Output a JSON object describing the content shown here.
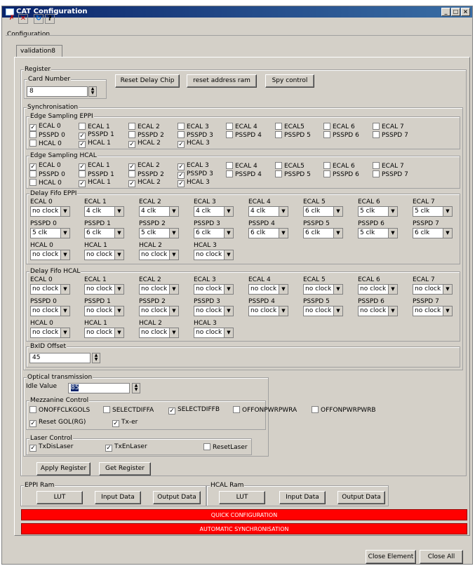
{
  "window": {
    "title": "CAT Configuration"
  },
  "toolbar": {
    "icons": [
      "remove-all-icon",
      "remove-icon",
      "refresh-icon",
      "help-icon"
    ]
  },
  "configuration_label": "Configuration",
  "tab_label": "validation8",
  "register": {
    "label": "Register",
    "card_number_label": "Card Number",
    "card_number": "8",
    "reset_delay_chip": "Reset Delay Chip",
    "reset_address_ram": "reset address ram",
    "spy_control": "Spy control"
  },
  "synchronisation": {
    "label": "Synchronisation",
    "edge_eppi": {
      "label": "Edge Sampling EPPI",
      "items": [
        {
          "label": "ECAL 0",
          "checked": true
        },
        {
          "label": "ECAL 1",
          "checked": false
        },
        {
          "label": "ECAL 2",
          "checked": false
        },
        {
          "label": "ECAL 3",
          "checked": false
        },
        {
          "label": "ECAL 4",
          "checked": false
        },
        {
          "label": "ECAL5",
          "checked": false
        },
        {
          "label": "ECAL 6",
          "checked": false
        },
        {
          "label": "ECAL 7",
          "checked": false
        },
        {
          "label": "PSSPD 0",
          "checked": false
        },
        {
          "label": "PSSPD 1",
          "checked": true
        },
        {
          "label": "PSSPD 2",
          "checked": false
        },
        {
          "label": "PSSPD 3",
          "checked": false
        },
        {
          "label": "PSSPD 4",
          "checked": false
        },
        {
          "label": "PSSPD 5",
          "checked": false
        },
        {
          "label": "PSSPD 6",
          "checked": false
        },
        {
          "label": "PSSPD 7",
          "checked": false
        },
        {
          "label": "HCAL 0",
          "checked": false
        },
        {
          "label": "HCAL 1",
          "checked": true
        },
        {
          "label": "HCAL 2",
          "checked": true
        },
        {
          "label": "HCAL 3",
          "checked": true
        }
      ]
    },
    "edge_hcal": {
      "label": "Edge Sampling HCAL",
      "items": [
        {
          "label": "ECAL 0",
          "checked": true
        },
        {
          "label": "ECAL 1",
          "checked": true
        },
        {
          "label": "ECAL 2",
          "checked": true
        },
        {
          "label": "ECAL 3",
          "checked": true
        },
        {
          "label": "ECAL 4",
          "checked": false
        },
        {
          "label": "ECAL5",
          "checked": false
        },
        {
          "label": "ECAL 6",
          "checked": false
        },
        {
          "label": "ECAL 7",
          "checked": false
        },
        {
          "label": "PSSPD 0",
          "checked": false
        },
        {
          "label": "PSSPD 1",
          "checked": false
        },
        {
          "label": "PSSPD 2",
          "checked": false
        },
        {
          "label": "PSSPD 3",
          "checked": true
        },
        {
          "label": "PSSPD 4",
          "checked": false
        },
        {
          "label": "PSSPD 5",
          "checked": false
        },
        {
          "label": "PSSPD 6",
          "checked": false
        },
        {
          "label": "PSSPD 7",
          "checked": false
        },
        {
          "label": "HCAL 0",
          "checked": false
        },
        {
          "label": "HCAL 1",
          "checked": true
        },
        {
          "label": "HCAL 2",
          "checked": true
        },
        {
          "label": "HCAL 3",
          "checked": true
        }
      ]
    },
    "fifo_eppi": {
      "label": "Delay Fifo EPPI",
      "items": [
        {
          "label": "ECAL 0",
          "value": "no clock"
        },
        {
          "label": "ECAL 1",
          "value": "4 clk"
        },
        {
          "label": "ECAL 2",
          "value": "4 clk"
        },
        {
          "label": "ECAL 3",
          "value": "4 clk"
        },
        {
          "label": "ECAL 4",
          "value": "4 clk"
        },
        {
          "label": "ECAL 5",
          "value": "6 clk"
        },
        {
          "label": "ECAL 6",
          "value": "5 clk"
        },
        {
          "label": "ECAL 7",
          "value": "5 clk"
        },
        {
          "label": "PSSPD 0",
          "value": "5 clk"
        },
        {
          "label": "PSSPD 1",
          "value": "6 clk"
        },
        {
          "label": "PSSPD 2",
          "value": "5 clk"
        },
        {
          "label": "PSSPD 3",
          "value": "6 clk"
        },
        {
          "label": "PSSPD 4",
          "value": "6 clk"
        },
        {
          "label": "PSSPD 5",
          "value": "6 clk"
        },
        {
          "label": "PSSPD 6",
          "value": "5 clk"
        },
        {
          "label": "PSSPD 7",
          "value": "6 clk"
        },
        {
          "label": "HCAL 0",
          "value": "no clock"
        },
        {
          "label": "HCAL 1",
          "value": "no clock"
        },
        {
          "label": "HCAL 2",
          "value": "no clock"
        },
        {
          "label": "HCAL 3",
          "value": "no clock"
        }
      ]
    },
    "fifo_hcal": {
      "label": "Delay Fifo HCAL",
      "items": [
        {
          "label": "ECAL 0",
          "value": "no clock"
        },
        {
          "label": "ECAL 1",
          "value": "no clock"
        },
        {
          "label": "ECAL 2",
          "value": "no clock"
        },
        {
          "label": "ECAL 3",
          "value": "no clock"
        },
        {
          "label": "ECAL 4",
          "value": "no clock"
        },
        {
          "label": "ECAL 5",
          "value": "no clock"
        },
        {
          "label": "ECAL 6",
          "value": "no clock"
        },
        {
          "label": "ECAL 7",
          "value": "no clock"
        },
        {
          "label": "PSSPD 0",
          "value": "no clock"
        },
        {
          "label": "PSSPD 1",
          "value": "no clock"
        },
        {
          "label": "PSSPD 2",
          "value": "no clock"
        },
        {
          "label": "PSSPD 3",
          "value": "no clock"
        },
        {
          "label": "PSSPD 4",
          "value": "no clock"
        },
        {
          "label": "PSSPD 5",
          "value": "no clock"
        },
        {
          "label": "PSSPD 6",
          "value": "no clock"
        },
        {
          "label": "PSSPD 7",
          "value": "no clock"
        },
        {
          "label": "HCAL 0",
          "value": "no clock"
        },
        {
          "label": "HCAL 1",
          "value": "no clock"
        },
        {
          "label": "HCAL 2",
          "value": "no clock"
        },
        {
          "label": "HCAL 3",
          "value": "no clock"
        }
      ]
    },
    "bxid_label": "BxID Offset",
    "bxid_value": "45"
  },
  "optical": {
    "label": "Optical transmission",
    "idle_label": "Idle Value",
    "idle_value": "85",
    "mezzanine_label": "Mezzanine Control",
    "mezzanine": [
      {
        "label": "ONOFFCLKGOLS",
        "checked": false
      },
      {
        "label": "SELECTDIFFA",
        "checked": false
      },
      {
        "label": "SELECTDIFFB",
        "checked": true
      },
      {
        "label": "OFFONPWRPWRA",
        "checked": false
      },
      {
        "label": "OFFONPWRPWRB",
        "checked": false
      },
      {
        "label": "Reset GOL(RG)",
        "checked": true
      },
      {
        "label": "Tx-er",
        "checked": true
      }
    ],
    "laser_label": "Laser Control",
    "laser": [
      {
        "label": "TxDisLaser",
        "checked": true
      },
      {
        "label": "TxEnLaser",
        "checked": true
      },
      {
        "label": "ResetLaser",
        "checked": false
      }
    ]
  },
  "apply_register": "Apply Register",
  "get_register": "Get Register",
  "eppi_ram": {
    "label": "EPPI Ram",
    "lut": "LUT",
    "input": "Input Data",
    "output": "Output Data"
  },
  "hcal_ram": {
    "label": "HCAL Ram",
    "lut": "LUT",
    "input": "Input Data",
    "output": "Output Data"
  },
  "quick_config": "QUICK CONFIGURATION",
  "auto_sync": "AUTOMATIC SYNCHRONISATION",
  "close_element": "Close Element",
  "close_all": "Close All"
}
